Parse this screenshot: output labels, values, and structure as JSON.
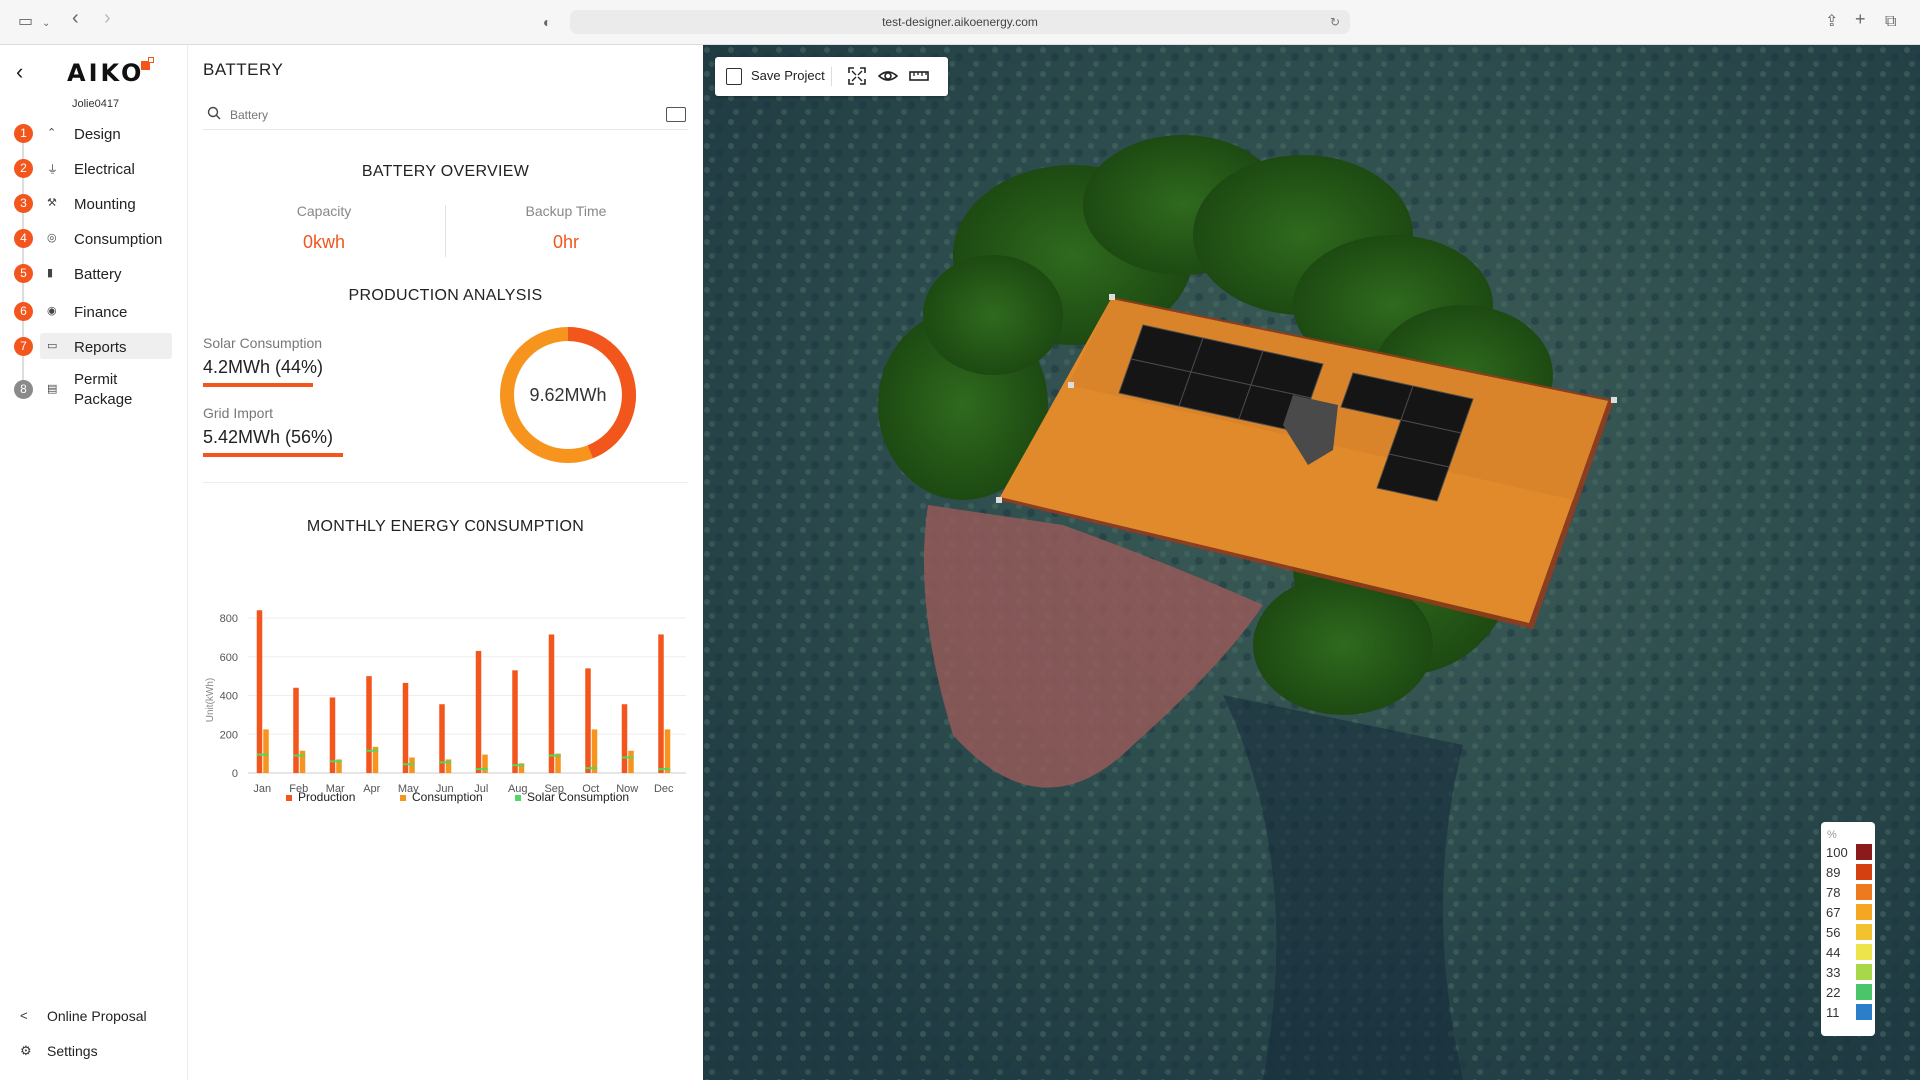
{
  "browser": {
    "url": "test-designer.aikoenergy.com"
  },
  "nav": {
    "logo": "AIKO",
    "username": "Jolie0417",
    "steps": [
      {
        "num": "1",
        "label": "Design",
        "icon": "design-icon"
      },
      {
        "num": "2",
        "label": "Electrical",
        "icon": "plug-icon"
      },
      {
        "num": "3",
        "label": "Mounting",
        "icon": "tools-icon"
      },
      {
        "num": "4",
        "label": "Consumption",
        "icon": "meter-icon"
      },
      {
        "num": "5",
        "label": "Battery",
        "icon": "battery-icon"
      },
      {
        "num": "6",
        "label": "Finance",
        "icon": "coin-icon"
      },
      {
        "num": "7",
        "label": "Reports",
        "icon": "folder-icon"
      },
      {
        "num": "8",
        "label": "Permit",
        "label2": "Package",
        "icon": "document-icon"
      }
    ],
    "bottom": {
      "online_proposal": "Online Proposal",
      "settings": "Settings"
    }
  },
  "panel": {
    "title": "BATTERY",
    "search_placeholder": "Battery",
    "overview": {
      "title": "BATTERY OVERVIEW",
      "capacity_label": "Capacity",
      "capacity_value": "0kwh",
      "backup_label": "Backup Time",
      "backup_value": "0hr"
    },
    "production": {
      "title": "PRODUCTION ANALYSIS",
      "solar_label": "Solar Consumption",
      "solar_value": "4.2MWh  (44%)",
      "solar_pct": 0.44,
      "grid_label": "Grid Import",
      "grid_value": "5.42MWh  (56%)",
      "grid_pct": 0.56,
      "total": "9.62MWh"
    },
    "monthly_title": "MONTHLY ENERGY C0NSUMPTION"
  },
  "chart_data": {
    "type": "bar",
    "title": "MONTHLY ENERGY C0NSUMPTION",
    "ylabel": "Unit(kWh)",
    "ylim": [
      0,
      800
    ],
    "yticks": [
      0,
      200,
      400,
      600,
      800
    ],
    "categories": [
      "Jan",
      "Feb",
      "Mar",
      "Apr",
      "May",
      "Jun",
      "Jul",
      "Aug",
      "Sep",
      "Oct",
      "Now",
      "Dec"
    ],
    "series": [
      {
        "name": "Production",
        "color": "#f2561d",
        "values": [
          840,
          440,
          390,
          500,
          465,
          355,
          630,
          530,
          715,
          540,
          355,
          715
        ]
      },
      {
        "name": "Consumption",
        "color": "#f7941d",
        "values": [
          225,
          115,
          70,
          135,
          80,
          70,
          95,
          50,
          100,
          225,
          115,
          225
        ]
      },
      {
        "name": "Solar Consumption",
        "color": "#4cd964",
        "values": [
          95,
          90,
          60,
          115,
          45,
          55,
          20,
          40,
          90,
          25,
          80,
          20
        ]
      }
    ]
  },
  "map": {
    "toolbar": {
      "save_label": "Save Project"
    },
    "heat_legend": {
      "unit": "%",
      "levels": [
        {
          "label": "100",
          "color": "#8b1a1a"
        },
        {
          "label": "89",
          "color": "#d4400f"
        },
        {
          "label": "78",
          "color": "#ee7a1f"
        },
        {
          "label": "67",
          "color": "#f5a623"
        },
        {
          "label": "56",
          "color": "#f2c230"
        },
        {
          "label": "44",
          "color": "#ece44a"
        },
        {
          "label": "33",
          "color": "#a8d84a"
        },
        {
          "label": "22",
          "color": "#4cc46a"
        },
        {
          "label": "11",
          "color": "#2a7fc8"
        }
      ]
    }
  }
}
